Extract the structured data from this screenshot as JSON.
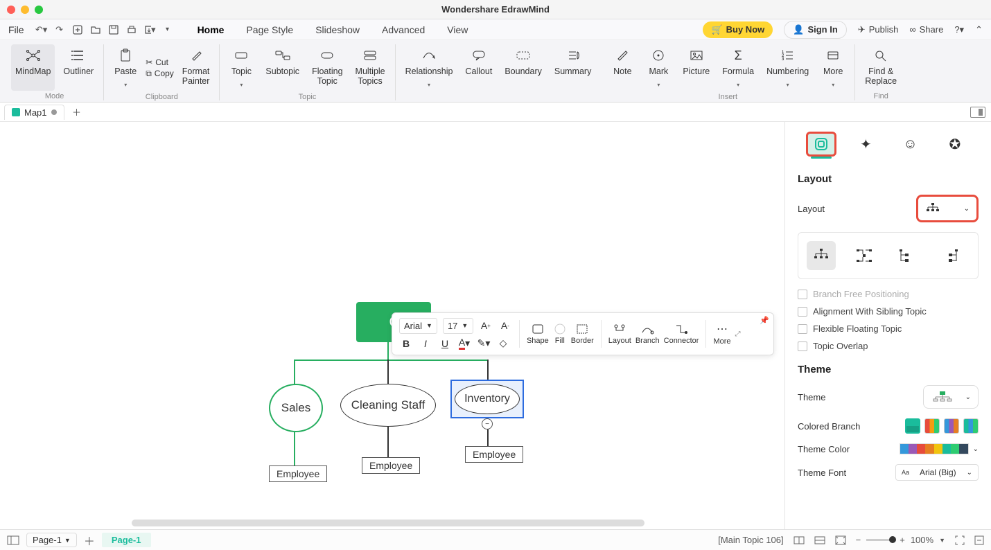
{
  "app_title": "Wondershare EdrawMind",
  "menu": {
    "file": "File"
  },
  "main_tabs": [
    "Home",
    "Page Style",
    "Slideshow",
    "Advanced",
    "View"
  ],
  "main_tab_active": "Home",
  "header_actions": {
    "buy": "Buy Now",
    "signin": "Sign In",
    "publish": "Publish",
    "share": "Share"
  },
  "ribbon": {
    "mode": {
      "mindmap": "MindMap",
      "outliner": "Outliner",
      "label": "Mode"
    },
    "clipboard": {
      "paste": "Paste",
      "cut": "Cut",
      "copy": "Copy",
      "format_painter": "Format\nPainter",
      "label": "Clipboard"
    },
    "topic": {
      "topic": "Topic",
      "subtopic": "Subtopic",
      "floating": "Floating\nTopic",
      "multiple": "Multiple\nTopics",
      "label": "Topic"
    },
    "insert_left": {
      "relationship": "Relationship",
      "callout": "Callout",
      "boundary": "Boundary",
      "summary": "Summary"
    },
    "insert_right": {
      "note": "Note",
      "mark": "Mark",
      "picture": "Picture",
      "formula": "Formula",
      "numbering": "Numbering",
      "more": "More",
      "label": "Insert"
    },
    "find": {
      "find_replace": "Find &\nReplace",
      "label": "Find"
    }
  },
  "doc_tab": "Map1",
  "canvas": {
    "owner": "Ow",
    "sales": "Sales",
    "cleaning": "Cleaning Staff",
    "inventory": "Inventory",
    "employee": "Employee"
  },
  "floatbar": {
    "font": "Arial",
    "size": "17",
    "shape": "Shape",
    "fill": "Fill",
    "border": "Border",
    "layout": "Layout",
    "branch": "Branch",
    "connector": "Connector",
    "more": "More"
  },
  "side": {
    "layout_h": "Layout",
    "layout_lbl": "Layout",
    "branch_free": "Branch Free Positioning",
    "align_sibling": "Alignment With Sibling Topic",
    "flexible": "Flexible Floating Topic",
    "overlap": "Topic Overlap",
    "theme_h": "Theme",
    "theme_lbl": "Theme",
    "colored_branch": "Colored Branch",
    "theme_color": "Theme Color",
    "theme_font": "Theme Font",
    "theme_font_val": "Arial (Big)"
  },
  "status": {
    "selection": "[Main Topic 106]",
    "page_sel": "Page-1",
    "page_tab": "Page-1",
    "zoom": "100%"
  }
}
